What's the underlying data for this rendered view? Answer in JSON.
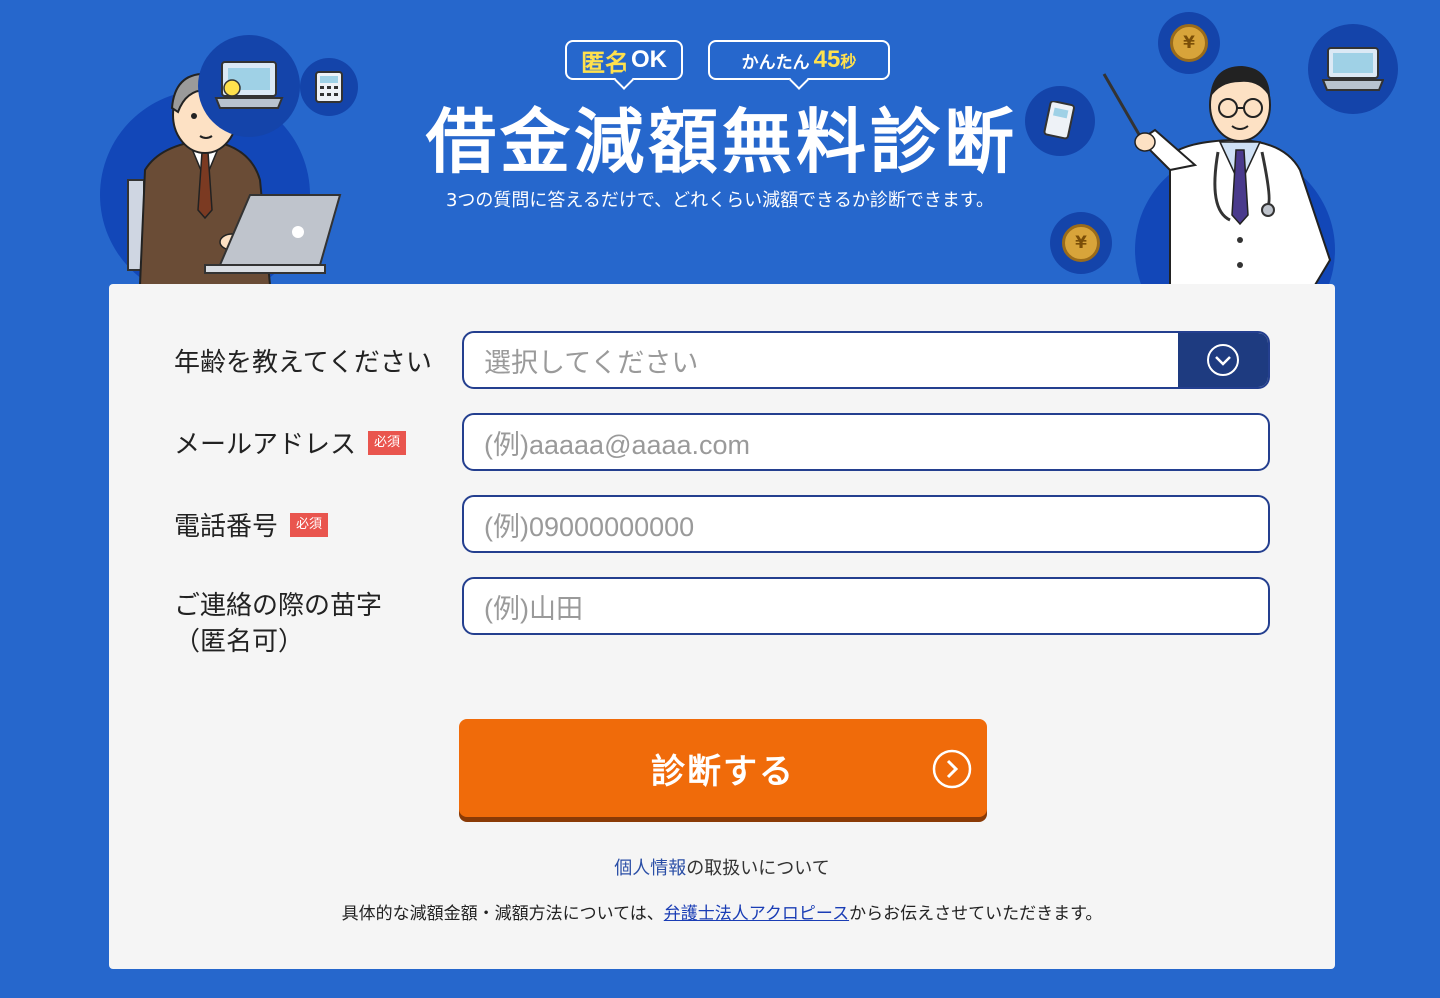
{
  "hero": {
    "badge_anon": {
      "yellow": "匿名",
      "white": "OK"
    },
    "badge_easy": {
      "prefix": "かんたん",
      "number": "45",
      "unit": "秒"
    },
    "title": "借金減額無料診断",
    "subtitle": "3つの質問に答えるだけで、どれくらい減額できるか診断できます。",
    "coin_symbol": "¥"
  },
  "form": {
    "age": {
      "label": "年齢を教えてください",
      "placeholder": "選択してください"
    },
    "email": {
      "label": "メールアドレス",
      "required": "必須",
      "placeholder": "(例)aaaaa@aaaa.com"
    },
    "phone": {
      "label": "電話番号",
      "required": "必須",
      "placeholder": "(例)09000000000"
    },
    "surname": {
      "label_line1": "ご連絡の際の苗字",
      "label_line2": "（匿名可）",
      "placeholder": "(例)山田"
    },
    "submit_label": "診断する"
  },
  "footer": {
    "privacy_link": "個人情報",
    "privacy_rest": "の取扱いについて",
    "note_before": "具体的な減額金額・減額方法については、",
    "note_link": "弁護士法人アクロピース",
    "note_after": "からお伝えさせていただきます。"
  },
  "colors": {
    "background": "#2667cc",
    "card": "#f5f5f5",
    "field_border": "#243f8f",
    "select_arrow_bg": "#1e3b80",
    "submit": "#f06b0a",
    "required_badge": "#e9554e",
    "badge_highlight": "#ffe14d"
  },
  "icons": [
    "businessman-illustration",
    "doctor-illustration",
    "laptop-icon",
    "calculator-icon",
    "coin-icon",
    "chevron-down-icon",
    "chevron-right-icon"
  ]
}
